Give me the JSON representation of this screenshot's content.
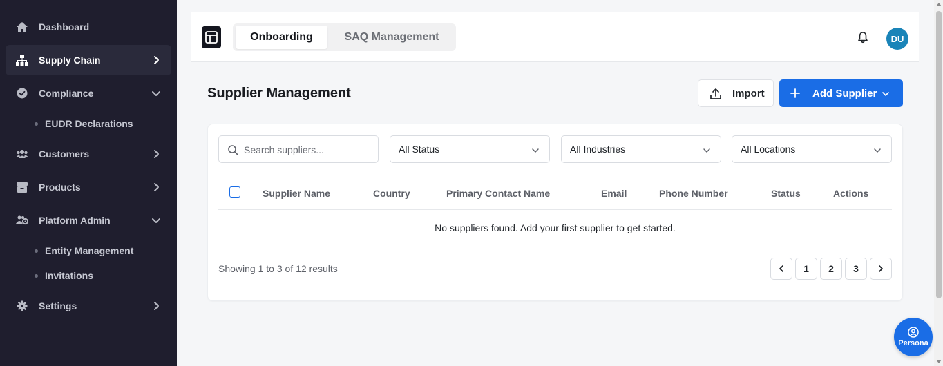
{
  "sidebar": {
    "items": [
      {
        "label": "Dashboard",
        "icon": "home-icon"
      },
      {
        "label": "Supply Chain",
        "icon": "sitemap-icon",
        "active": true,
        "chevron": "right"
      },
      {
        "label": "Compliance",
        "icon": "check-circle-icon",
        "chevron": "down"
      },
      {
        "label": "Customers",
        "icon": "users-icon",
        "chevron": "right"
      },
      {
        "label": "Products",
        "icon": "box-icon",
        "chevron": "right"
      },
      {
        "label": "Platform Admin",
        "icon": "users-cog-icon",
        "chevron": "down"
      },
      {
        "label": "Settings",
        "icon": "gear-icon",
        "chevron": "right"
      }
    ],
    "compliance_sub": [
      "EUDR Declarations"
    ],
    "admin_sub": [
      "Entity Management",
      "Invitations"
    ]
  },
  "topbar": {
    "tabs": [
      "Onboarding",
      "SAQ Management"
    ],
    "active_tab": "Onboarding",
    "avatar_initials": "DU"
  },
  "page": {
    "title": "Supplier Management",
    "import_label": "Import",
    "add_label": "Add Supplier"
  },
  "filters": {
    "search_placeholder": "Search suppliers...",
    "status": "All Status",
    "industries": "All Industries",
    "locations": "All Locations"
  },
  "table": {
    "columns": [
      "Supplier Name",
      "Country",
      "Primary Contact Name",
      "Email",
      "Phone Number",
      "Status",
      "Actions"
    ],
    "rows": [],
    "empty_message": "No suppliers found. Add your first supplier to get started."
  },
  "pagination": {
    "summary": "Showing 1 to 3 of 12 results",
    "pages": [
      "1",
      "2",
      "3"
    ]
  },
  "persona": {
    "label": "Persona"
  },
  "colors": {
    "sidebar_bg": "#1f1e2e",
    "primary": "#1a6de6",
    "avatar": "#1a84b8"
  }
}
